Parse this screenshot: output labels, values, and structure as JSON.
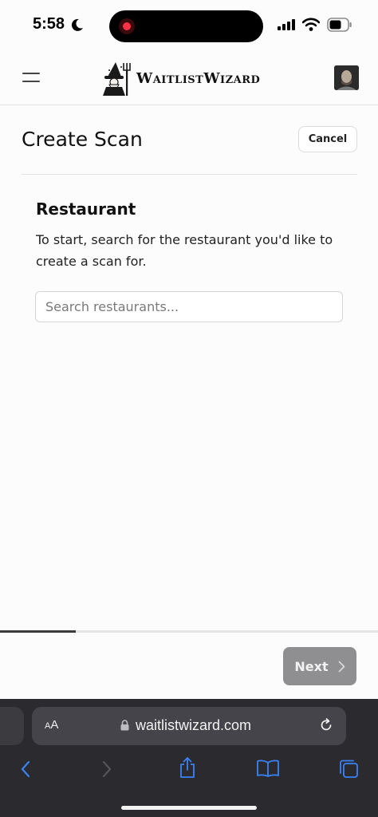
{
  "status_bar": {
    "time": "5:58"
  },
  "header": {
    "menu_icon": "hamburger-icon",
    "brand_name": "WaitlistWizard",
    "avatar": "user-avatar"
  },
  "page": {
    "title": "Create Scan",
    "cancel_label": "Cancel",
    "section_title": "Restaurant",
    "section_description": "To start, search for the restaurant you'd like to create a scan for.",
    "search": {
      "value": "",
      "placeholder": "Search restaurants..."
    }
  },
  "progress": {
    "fraction": 0.2
  },
  "footer": {
    "next_label": "Next",
    "next_icon": "chevron-right-icon"
  },
  "safari": {
    "text_size_label": "AA",
    "url": "waitlistwizard.com",
    "toolbar": [
      "back-icon",
      "forward-icon",
      "share-icon",
      "bookmarks-icon",
      "tabs-icon"
    ]
  },
  "colors": {
    "accent_dark": "#3a3a3c",
    "next_disabled": "#8f8e91",
    "safari_blue": "#3b82f6",
    "recording_red": "#ff3146"
  }
}
